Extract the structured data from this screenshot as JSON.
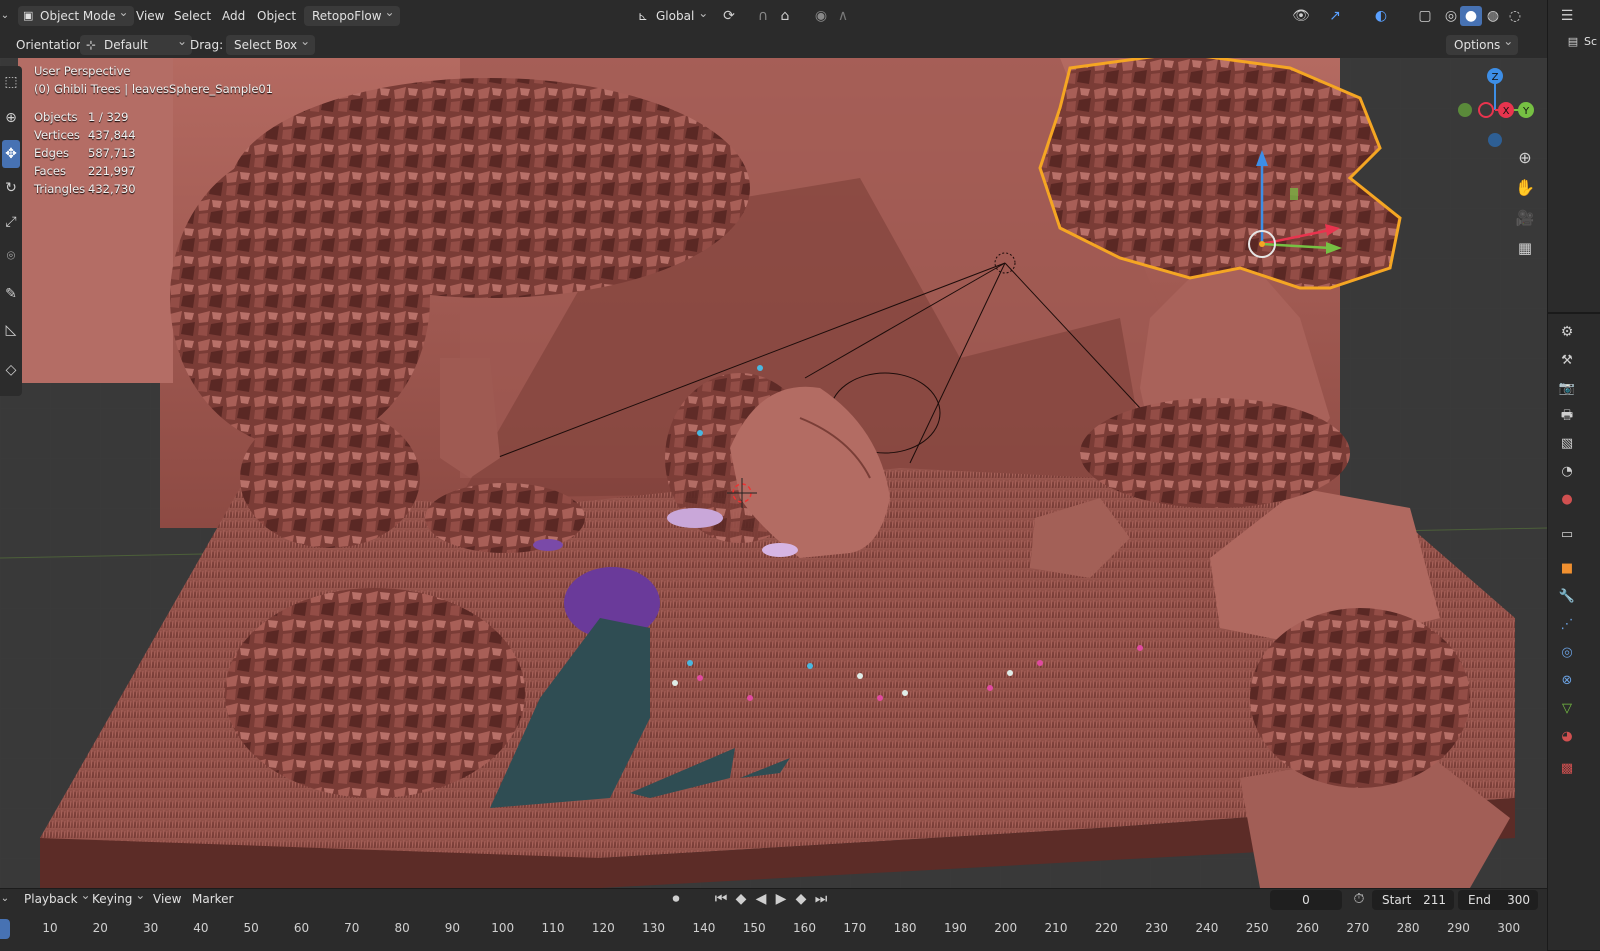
{
  "header": {
    "mode": "Object Mode",
    "menus": [
      "View",
      "Select",
      "Add",
      "Object"
    ],
    "addon": "RetopoFlow",
    "transform_orientation": "Global",
    "options_label": "Options"
  },
  "tool_header": {
    "orientation_label": "Orientation:",
    "orientation_value": "Default",
    "drag_label": "Drag:",
    "drag_value": "Select Box"
  },
  "overlay": {
    "view_name": "User Perspective",
    "active_object": "(0) Ghibli Trees | leavesSphere_Sample01",
    "stats": [
      {
        "label": "Objects",
        "value": "1 / 329"
      },
      {
        "label": "Vertices",
        "value": "437,844"
      },
      {
        "label": "Edges",
        "value": "587,713"
      },
      {
        "label": "Faces",
        "value": "221,997"
      },
      {
        "label": "Triangles",
        "value": "432,730"
      }
    ]
  },
  "gizmo": {
    "z": "Z",
    "x": "X",
    "y": "Y"
  },
  "timeline": {
    "menus": [
      "Playback",
      "Keying",
      "View",
      "Marker"
    ],
    "current_frame": "0",
    "start_label": "Start",
    "start_value": "211",
    "end_label": "End",
    "end_value": "300",
    "ticks": [
      "10",
      "20",
      "30",
      "40",
      "50",
      "60",
      "70",
      "80",
      "90",
      "100",
      "110",
      "120",
      "130",
      "140",
      "150",
      "160",
      "170",
      "180",
      "190",
      "200",
      "210",
      "220",
      "230",
      "240",
      "250",
      "260",
      "270",
      "280",
      "290",
      "300"
    ]
  },
  "outliner": {
    "scene_label_partial": "Sc"
  },
  "colors": {
    "selection_outline": "#f5a623",
    "clay": "#8a4a45",
    "accent_blue": "#4772b3",
    "axis_x": "#e8344e",
    "axis_y": "#76c043",
    "axis_z": "#3d8ee6"
  }
}
